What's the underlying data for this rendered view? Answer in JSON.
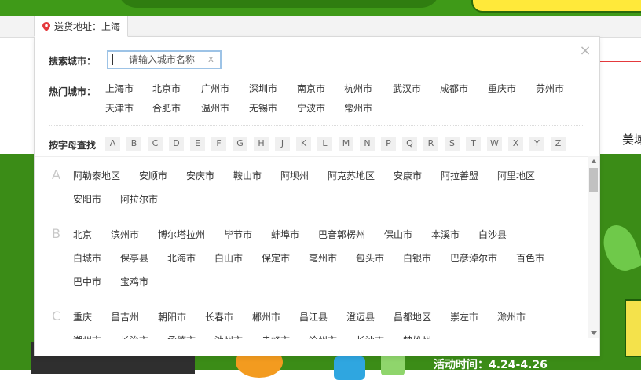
{
  "location_tab": {
    "prefix": "送货地址：",
    "city": "上海"
  },
  "popup": {
    "close_glyph": "×",
    "search": {
      "label": "搜索城市：",
      "placeholder": "请输入城市名称",
      "value": "",
      "clear_glyph": "x"
    },
    "hot": {
      "label": "热门城市：",
      "cities": [
        "上海市",
        "北京市",
        "广州市",
        "深圳市",
        "南京市",
        "杭州市",
        "武汉市",
        "成都市",
        "重庆市",
        "苏州市",
        "天津市",
        "合肥市",
        "温州市",
        "无锡市",
        "宁波市",
        "常州市"
      ]
    },
    "alpha": {
      "label": "按字母查找",
      "letters": [
        "A",
        "B",
        "C",
        "D",
        "E",
        "F",
        "G",
        "H",
        "J",
        "K",
        "L",
        "M",
        "N",
        "P",
        "Q",
        "R",
        "S",
        "T",
        "W",
        "X",
        "Y",
        "Z"
      ]
    },
    "groups": [
      {
        "letter": "A",
        "cities": [
          "阿勒泰地区",
          "安顺市",
          "安庆市",
          "鞍山市",
          "阿坝州",
          "阿克苏地区",
          "安康市",
          "阿拉善盟",
          "阿里地区",
          "安阳市",
          "阿拉尔市"
        ]
      },
      {
        "letter": "B",
        "cities": [
          "北京",
          "滨州市",
          "博尔塔拉州",
          "毕节市",
          "蚌埠市",
          "巴音郭楞州",
          "保山市",
          "本溪市",
          "白沙县",
          "白城市",
          "保亭县",
          "北海市",
          "白山市",
          "保定市",
          "亳州市",
          "包头市",
          "白银市",
          "巴彦淖尔市",
          "百色市",
          "巴中市",
          "宝鸡市"
        ]
      },
      {
        "letter": "C",
        "cities": [
          "重庆",
          "昌吉州",
          "朝阳市",
          "长春市",
          "郴州市",
          "昌江县",
          "澄迈县",
          "昌都地区",
          "崇左市",
          "滁州市",
          "潮州市",
          "长治市",
          "承德市",
          "池州市",
          "赤峰市",
          "沧州市",
          "长沙市",
          "楚雄州"
        ]
      }
    ]
  },
  "page": {
    "right_text": "美域",
    "promo_text": "活动时间：4.24-4.26"
  },
  "colors": {
    "accent_red": "#e4393c",
    "pin_red": "#e4393c",
    "banner_green": "#3f9a18",
    "input_border": "#9dc3e6"
  }
}
